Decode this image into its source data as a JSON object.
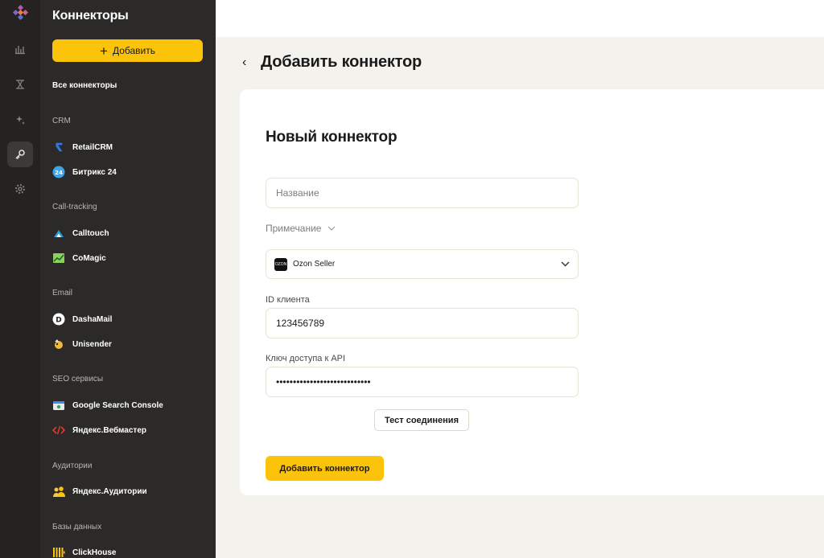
{
  "sidebar": {
    "title": "Коннекторы",
    "add_label": "Добавить",
    "all_connectors": "Все коннекторы",
    "sections": [
      {
        "label": "CRM",
        "items": [
          {
            "label": "RetailCRM",
            "icon": "retailcrm-icon"
          },
          {
            "label": "Битрикс 24",
            "icon": "bitrix24-icon"
          }
        ]
      },
      {
        "label": "Call-tracking",
        "items": [
          {
            "label": "Calltouch",
            "icon": "calltouch-icon"
          },
          {
            "label": "CoMagic",
            "icon": "comagic-icon"
          }
        ]
      },
      {
        "label": "Email",
        "items": [
          {
            "label": "DashaMail",
            "icon": "dashamail-icon"
          },
          {
            "label": "Unisender",
            "icon": "unisender-icon"
          }
        ]
      },
      {
        "label": "SEO сервисы",
        "items": [
          {
            "label": "Google Search Console",
            "icon": "google-search-console-icon"
          },
          {
            "label": "Яндекс.Вебмастер",
            "icon": "yandex-webmaster-icon"
          }
        ]
      },
      {
        "label": "Аудитории",
        "items": [
          {
            "label": "Яндекс.Аудитории",
            "icon": "yandex-audience-icon"
          }
        ]
      },
      {
        "label": "Базы данных",
        "items": [
          {
            "label": "ClickHouse",
            "icon": "clickhouse-icon"
          }
        ]
      }
    ]
  },
  "rail": {
    "icons": [
      "logo-icon",
      "chart-icon",
      "transform-icon",
      "sparkle-icon",
      "key-icon",
      "settings-icon"
    ],
    "active": "key-icon"
  },
  "page": {
    "back_icon": "chevron-left-icon",
    "title": "Добавить коннектор"
  },
  "form": {
    "title": "Новый коннектор",
    "name_placeholder": "Название",
    "note_label": "Примечание",
    "connector_type": "Ozon Seller",
    "connector_logo_text": "OZON",
    "client_id_label": "ID клиента",
    "client_id_value": "123456789",
    "api_key_label": "Ключ доступа к API",
    "api_key_value": "••••••••••••••••••••••••••••",
    "test_label": "Тест соединения",
    "submit_label": "Добавить коннектор"
  },
  "colors": {
    "accent": "#fcc30b",
    "sidebar_bg": "#2b2a28",
    "rail_bg": "#242322",
    "page_bg": "#f3f2ed"
  }
}
